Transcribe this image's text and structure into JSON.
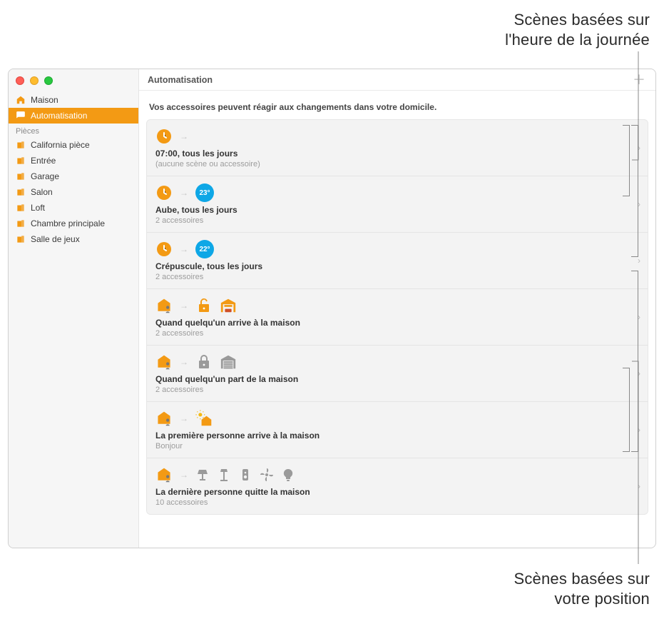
{
  "callouts": {
    "top": "Scènes basées sur\nl'heure de la journée",
    "bottom": "Scènes basées sur\nvotre position"
  },
  "window": {
    "title": "Automatisation",
    "subtitle": "Vos accessoires peuvent réagir aux changements dans votre domicile."
  },
  "sidebar": {
    "home_label": "Maison",
    "automation_label": "Automatisation",
    "section_label": "Pièces",
    "rooms": [
      {
        "label": "California pièce"
      },
      {
        "label": "Entrée"
      },
      {
        "label": "Garage"
      },
      {
        "label": "Salon"
      },
      {
        "label": "Loft"
      },
      {
        "label": "Chambre principale"
      },
      {
        "label": "Salle de jeux"
      }
    ]
  },
  "automations": [
    {
      "title": "07:00, tous les jours",
      "sub": "(aucune scène ou accessoire)",
      "icons": [
        "clock"
      ]
    },
    {
      "title": "Aube, tous les jours",
      "sub": "2 accessoires",
      "icons": [
        "clock",
        "temp23"
      ]
    },
    {
      "title": "Crépuscule, tous les jours",
      "sub": "2 accessoires",
      "icons": [
        "clock",
        "temp22"
      ]
    },
    {
      "title": "Quand quelqu'un arrive à la maison",
      "sub": "2 accessoires",
      "icons": [
        "homeperson",
        "unlock",
        "garageopen"
      ]
    },
    {
      "title": "Quand quelqu'un part de la maison",
      "sub": "2 accessoires",
      "icons": [
        "homeperson",
        "lockgrey",
        "garageclosed"
      ]
    },
    {
      "title": "La première personne arrive à la maison",
      "sub": "Bonjour",
      "icons": [
        "homeperson",
        "sunhome"
      ]
    },
    {
      "title": "La dernière personne quitte la maison",
      "sub": "10 accessoires",
      "icons": [
        "homeperson",
        "lamp1",
        "lamp2",
        "speaker",
        "fan",
        "bulb"
      ]
    }
  ],
  "temps": {
    "t23": "23°",
    "t22": "22°"
  }
}
